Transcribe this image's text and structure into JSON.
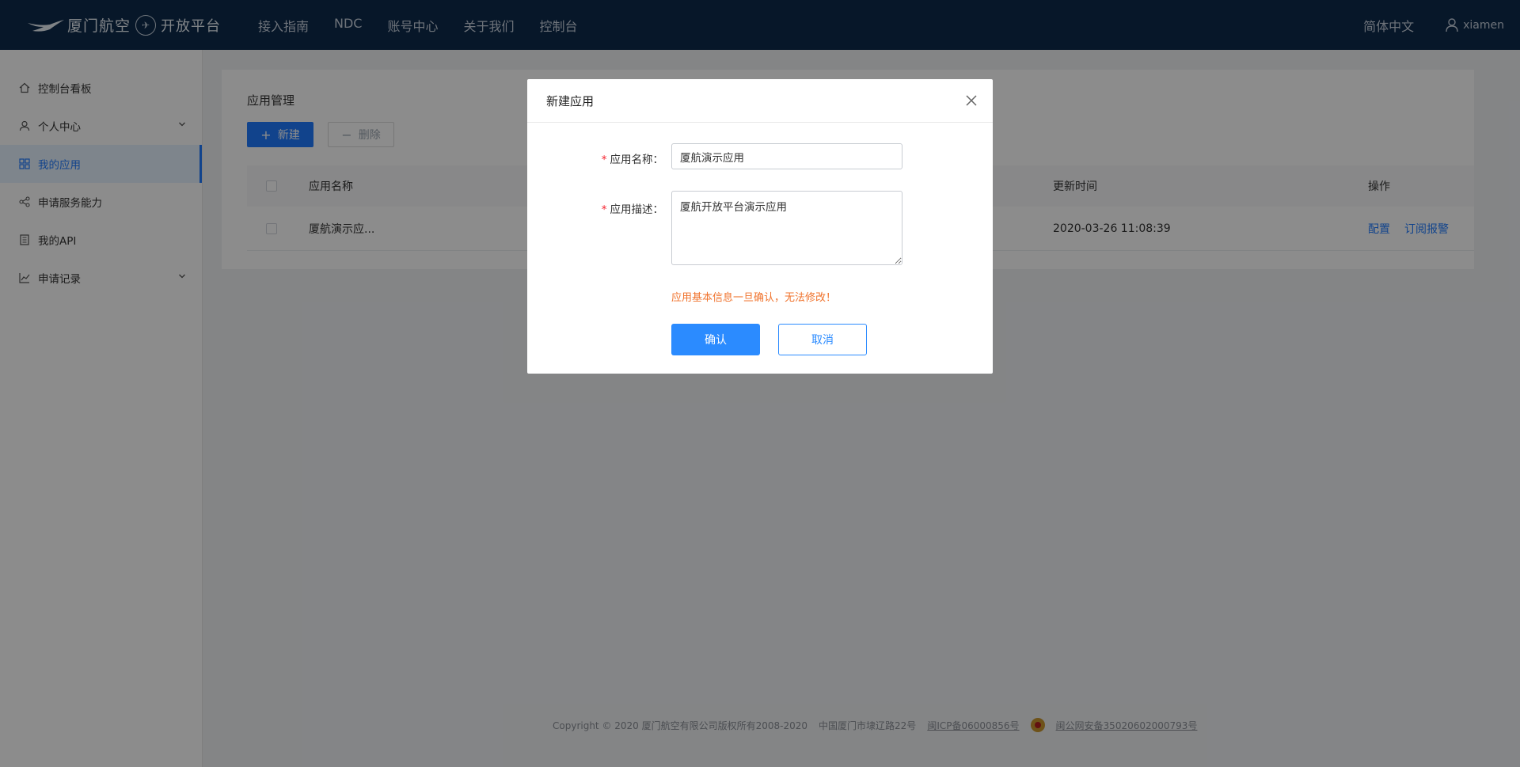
{
  "header": {
    "logo_text": "厦门航空",
    "logo_open_text": "开放平台",
    "nav": [
      "接入指南",
      "NDC",
      "账号中心",
      "关于我们",
      "控制台"
    ],
    "language": "简体中文",
    "username": "xiamen"
  },
  "sidebar": {
    "items": [
      {
        "label": "控制台看板",
        "icon": "home-icon"
      },
      {
        "label": "个人中心",
        "icon": "user-icon"
      },
      {
        "label": "我的应用",
        "icon": "apps-icon",
        "active": true
      },
      {
        "label": "申请服务能力",
        "icon": "share-icon"
      },
      {
        "label": "我的API",
        "icon": "book-icon"
      },
      {
        "label": "申请记录",
        "icon": "chart-icon"
      }
    ]
  },
  "main": {
    "title": "应用管理",
    "new_button": "新建",
    "delete_button": "删除",
    "table": {
      "columns": [
        "应用名称",
        "更新时间",
        "操作"
      ],
      "rows": [
        {
          "name": "厦航演示应...",
          "updated": "2020-03-26 11:08:39",
          "ops": [
            "配置",
            "订阅报警"
          ]
        }
      ]
    }
  },
  "footer": {
    "copyright": "Copyright © 2020 厦门航空有限公司版权所有2008-2020",
    "address": "中国厦门市埭辽路22号",
    "icp": "闽ICP备06000856号",
    "police": "闽公网安备35020602000793号"
  },
  "modal": {
    "title": "新建应用",
    "name_label": "应用名称：",
    "name_value": "厦航演示应用",
    "desc_label": "应用描述：",
    "desc_value": "厦航开放平台演示应用",
    "warning": "应用基本信息一旦确认，无法修改！",
    "confirm": "确认",
    "cancel": "取消"
  },
  "colors": {
    "header_bg": "#0d2a4c",
    "primary": "#1f7bff",
    "warning": "#f0732d",
    "required": "#f5222d"
  }
}
